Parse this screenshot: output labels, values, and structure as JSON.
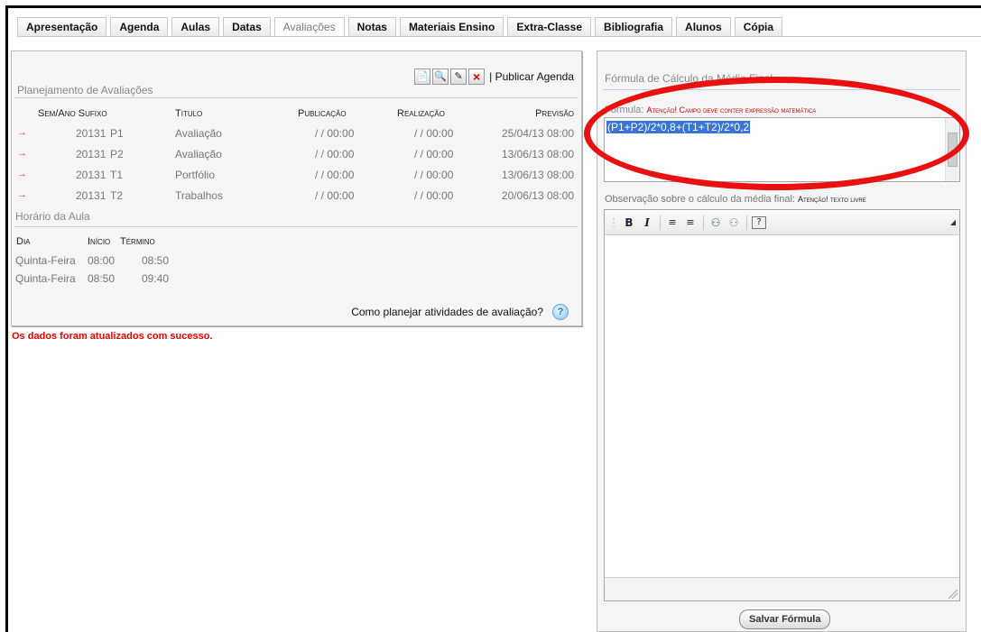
{
  "tabs": [
    {
      "label": "Apresentação",
      "active": false
    },
    {
      "label": "Agenda",
      "active": false
    },
    {
      "label": "Aulas",
      "active": false
    },
    {
      "label": "Datas",
      "active": false
    },
    {
      "label": "Avaliações",
      "active": true
    },
    {
      "label": "Notas",
      "active": false
    },
    {
      "label": "Materiais Ensino",
      "active": false
    },
    {
      "label": "Extra-Classe",
      "active": false
    },
    {
      "label": "Bibliografia",
      "active": false
    },
    {
      "label": "Alunos",
      "active": false
    },
    {
      "label": "Cópia",
      "active": false
    }
  ],
  "planning": {
    "title": "Planejamento de Avaliações",
    "publish_label": "| Publicar Agenda",
    "toolbar_icons": [
      "new-document-icon",
      "search-icon",
      "edit-icon",
      "delete-icon"
    ],
    "headers": {
      "semano_sufixo": "Sem/Ano Sufixo",
      "titulo": "Titulo",
      "publicacao": "Publicação",
      "realizacao": "Realização",
      "previsao": "Previsão"
    },
    "rows": [
      {
        "semano": "20131",
        "sufixo": "P1",
        "titulo": "Avaliação",
        "publicacao": "/ / 00:00",
        "realizacao": "/ / 00:00",
        "previsao": "25/04/13 08:00"
      },
      {
        "semano": "20131",
        "sufixo": "P2",
        "titulo": "Avaliação",
        "publicacao": "/ / 00:00",
        "realizacao": "/ / 00:00",
        "previsao": "13/06/13 08:00"
      },
      {
        "semano": "20131",
        "sufixo": "T1",
        "titulo": "Portfólio",
        "publicacao": "/ / 00:00",
        "realizacao": "/ / 00:00",
        "previsao": "13/06/13 08:00"
      },
      {
        "semano": "20131",
        "sufixo": "T2",
        "titulo": "Trabalhos",
        "publicacao": "/ / 00:00",
        "realizacao": "/ / 00:00",
        "previsao": "20/06/13 08:00"
      }
    ]
  },
  "schedule": {
    "title": "Horário da Aula",
    "headers": {
      "dia": "Dia",
      "inicio": "Início",
      "termino": "Término"
    },
    "rows": [
      {
        "dia": "Quinta-Feira",
        "inicio": "08:00",
        "termino": "08:50"
      },
      {
        "dia": "Quinta-Feira",
        "inicio": "08:50",
        "termino": "09:40"
      }
    ]
  },
  "help_text": "Como planejar atividades de avaliação?",
  "success_message": "Os dados foram atualizados com sucesso.",
  "formula": {
    "section_title": "Fórmula de Cálculo da Média Final",
    "label": "Fórmula:",
    "warning": "Atenção! Campo deve conter expressão matemática",
    "value": "(P1+P2)/2*0,8+(T1+T2)/2*0,2"
  },
  "observation": {
    "label": "Observação sobre o cálculo da média final:",
    "warning": "Atenção! texto livre",
    "content": ""
  },
  "save_button": "Salvar Fórmula",
  "colors": {
    "accent_red": "#d40000",
    "selection_blue": "#3875d7",
    "annotation_red": "#e81010"
  }
}
